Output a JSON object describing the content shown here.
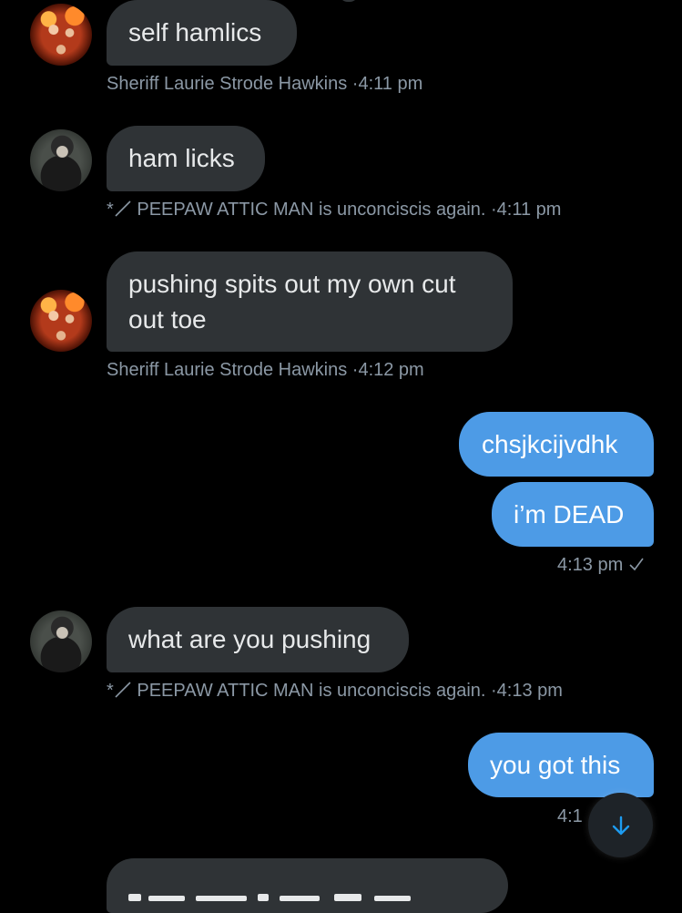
{
  "messages": [
    {
      "direction": "incoming",
      "avatar": "laurie-avatar",
      "text": "self hamlics",
      "sender": "Sheriff Laurie Strode Hawkins",
      "time": "4:11 pm"
    },
    {
      "direction": "incoming",
      "avatar": "peepaw-avatar",
      "text": "ham licks",
      "sender_prefix": "*",
      "sender": "PEEPAW ATTIC MAN is unconciscis again.",
      "time": "4:11 pm"
    },
    {
      "direction": "incoming",
      "avatar": "laurie-avatar",
      "text_line1": "pushing spits out my own cut",
      "text_line2": "out toe",
      "sender": "Sheriff Laurie Strode Hawkins",
      "time": "4:12 pm"
    },
    {
      "direction": "outgoing",
      "text": "chsjkcijvdhk"
    },
    {
      "direction": "outgoing",
      "text": "i’m DEAD",
      "time": "4:13 pm",
      "status": "sent-check-icon"
    },
    {
      "direction": "incoming",
      "avatar": "peepaw-avatar",
      "text": "what are you pushing",
      "sender_prefix": "*",
      "sender": "PEEPAW ATTIC MAN is unconciscis again.",
      "time": "4:13 pm"
    },
    {
      "direction": "outgoing",
      "text": "you got this",
      "time": "4:1"
    }
  ],
  "separator": "·",
  "scroll_button": {
    "icon": "arrow-down-icon"
  },
  "colors": {
    "background": "#000000",
    "incoming_bubble": "#2f3336",
    "outgoing_bubble": "#4d9be6",
    "meta_text": "#8b98a5",
    "accent": "#1d9bf0"
  }
}
